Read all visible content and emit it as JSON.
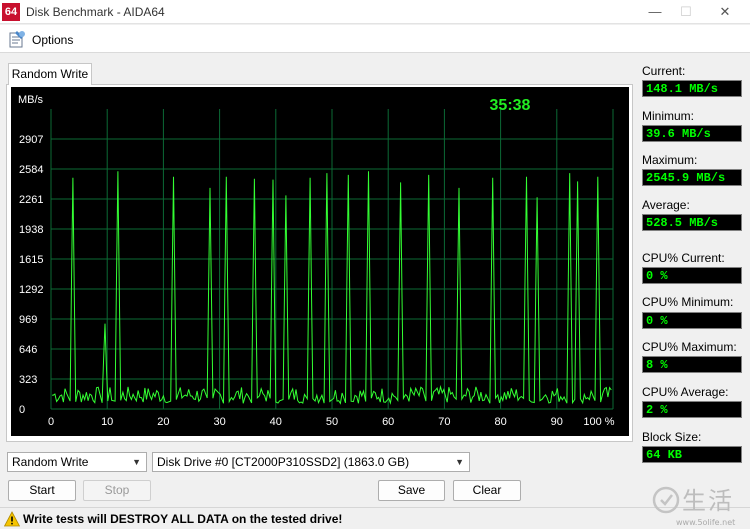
{
  "window": {
    "app_icon_text": "64",
    "title": "Disk Benchmark - AIDA64",
    "minimize": "—",
    "maximize": "☐",
    "close": "✕"
  },
  "menu": {
    "options_label": "Options"
  },
  "tab": {
    "label": "Random Write"
  },
  "chart_data": {
    "type": "line",
    "ylabel": "MB/s",
    "timer": "35:38",
    "y_ticks": [
      0,
      323,
      646,
      969,
      1292,
      1615,
      1938,
      2261,
      2584,
      2907
    ],
    "ylim": [
      0,
      3230
    ],
    "x_ticks": [
      "0",
      "10",
      "20",
      "30",
      "40",
      "50",
      "60",
      "70",
      "80",
      "90",
      "100 %"
    ],
    "xlim": [
      0,
      100
    ],
    "grid": true,
    "background": "#000000",
    "grid_color": "#0b6a35",
    "line_color": "#33ff33",
    "text_color": "#ffffff",
    "timer_color": "#22ee22",
    "series": [
      {
        "spikes": [
          {
            "x": 3.9,
            "y": 2490
          },
          {
            "x": 9.6,
            "y": 920
          },
          {
            "x": 11.9,
            "y": 2560
          },
          {
            "x": 21.8,
            "y": 2500
          },
          {
            "x": 28.3,
            "y": 2380
          },
          {
            "x": 31.2,
            "y": 2500
          },
          {
            "x": 36.2,
            "y": 2480
          },
          {
            "x": 39.5,
            "y": 2470
          },
          {
            "x": 41.8,
            "y": 2300
          },
          {
            "x": 46.1,
            "y": 2490
          },
          {
            "x": 49.1,
            "y": 2540
          },
          {
            "x": 52.9,
            "y": 2520
          },
          {
            "x": 56.5,
            "y": 2560
          },
          {
            "x": 62.2,
            "y": 2440
          },
          {
            "x": 67.2,
            "y": 2520
          },
          {
            "x": 72.6,
            "y": 2380
          },
          {
            "x": 78.6,
            "y": 2490
          },
          {
            "x": 84.6,
            "y": 2500
          },
          {
            "x": 86.5,
            "y": 2280
          },
          {
            "x": 92.3,
            "y": 2540
          },
          {
            "x": 93.7,
            "y": 2450
          },
          {
            "x": 97.3,
            "y": 2500
          }
        ],
        "baseline_range": [
          60,
          240
        ]
      }
    ]
  },
  "stats": {
    "current_label": "Current:",
    "current_value": "148.1 MB/s",
    "minimum_label": "Minimum:",
    "minimum_value": "39.6 MB/s",
    "maximum_label": "Maximum:",
    "maximum_value": "2545.9 MB/s",
    "average_label": "Average:",
    "average_value": "528.5 MB/s",
    "cpu_current_label": "CPU% Current:",
    "cpu_current_value": "0 %",
    "cpu_minimum_label": "CPU% Minimum:",
    "cpu_minimum_value": "0 %",
    "cpu_maximum_label": "CPU% Maximum:",
    "cpu_maximum_value": "8 %",
    "cpu_average_label": "CPU% Average:",
    "cpu_average_value": "2 %",
    "block_size_label": "Block Size:",
    "block_size_value": "64 KB"
  },
  "controls": {
    "test_select": "Random Write",
    "drive_select": "Disk Drive #0  [CT2000P310SSD2]  (1863.0 GB)",
    "start": "Start",
    "stop": "Stop",
    "save": "Save",
    "clear": "Clear"
  },
  "status": {
    "warning": "Write tests will DESTROY ALL DATA on the tested drive!"
  },
  "watermark": {
    "text": "生活",
    "url": "www.5olife.net"
  }
}
